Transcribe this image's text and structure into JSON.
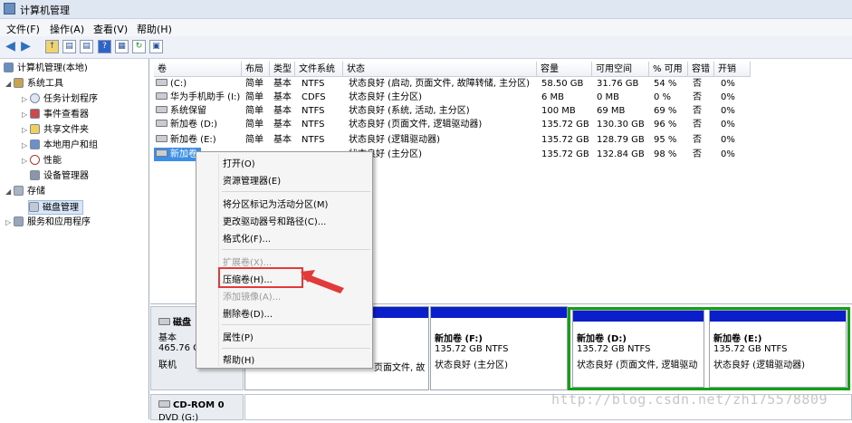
{
  "window": {
    "title": "计算机管理"
  },
  "menu": [
    "文件(F)",
    "操作(A)",
    "查看(V)",
    "帮助(H)"
  ],
  "toolbar_icons": [
    "back-arrow-icon",
    "forward-arrow-icon",
    "up-folder-icon",
    "show-hide-tree-icon",
    "properties-icon",
    "help-icon",
    "view-icon",
    "refresh-icon",
    "export-icon"
  ],
  "tree": {
    "root": "计算机管理(本地)",
    "system_tools": "系统工具",
    "task_scheduler": "任务计划程序",
    "event_viewer": "事件查看器",
    "shared_folders": "共享文件夹",
    "local_users": "本地用户和组",
    "performance": "性能",
    "device_manager": "设备管理器",
    "storage": "存储",
    "disk_management": "磁盘管理",
    "services": "服务和应用程序"
  },
  "table": {
    "headers": [
      "卷",
      "布局",
      "类型",
      "文件系统",
      "状态",
      "容量",
      "可用空间",
      "% 可用",
      "容错",
      "开销"
    ],
    "rows": [
      [
        "(C:)",
        "简单",
        "基本",
        "NTFS",
        "状态良好 (启动, 页面文件, 故障转储, 主分区)",
        "58.50 GB",
        "31.76 GB",
        "54 %",
        "否",
        "0%"
      ],
      [
        "华为手机助手 (I:)",
        "简单",
        "基本",
        "CDFS",
        "状态良好 (主分区)",
        "6 MB",
        "0 MB",
        "0 %",
        "否",
        "0%"
      ],
      [
        "系统保留",
        "简单",
        "基本",
        "NTFS",
        "状态良好 (系统, 活动, 主分区)",
        "100 MB",
        "69 MB",
        "69 %",
        "否",
        "0%"
      ],
      [
        "新加卷 (D:)",
        "简单",
        "基本",
        "NTFS",
        "状态良好 (页面文件, 逻辑驱动器)",
        "135.72 GB",
        "130.30 GB",
        "96 %",
        "否",
        "0%"
      ],
      [
        "新加卷 (E:)",
        "简单",
        "基本",
        "NTFS",
        "状态良好 (逻辑驱动器)",
        "135.72 GB",
        "128.79 GB",
        "95 %",
        "否",
        "0%"
      ],
      [
        "新加卷",
        "",
        "",
        "",
        "状态良好 (主分区)",
        "135.72 GB",
        "132.84 GB",
        "98 %",
        "否",
        "0%"
      ]
    ]
  },
  "disk0": {
    "name": "磁盘",
    "type": "基本",
    "size": "465.76 G",
    "status": "联机"
  },
  "partitions": {
    "c_fragment": "页面文件, 故",
    "f": {
      "name": "新加卷 (F:)",
      "size": "135.72 GB NTFS",
      "status": "状态良好 (主分区)"
    },
    "d": {
      "name": "新加卷 (D:)",
      "size": "135.72 GB NTFS",
      "status": "状态良好 (页面文件, 逻辑驱动"
    },
    "e": {
      "name": "新加卷 (E:)",
      "size": "135.72 GB NTFS",
      "status": "状态良好 (逻辑驱动器)"
    }
  },
  "cdrom": {
    "name": "CD-ROM 0",
    "label": "DVD (G:)"
  },
  "context_menu": {
    "open": "打开(O)",
    "explore": "资源管理器(E)",
    "mark_active": "将分区标记为活动分区(M)",
    "change_letter": "更改驱动器号和路径(C)...",
    "format": "格式化(F)...",
    "extend": "扩展卷(X)...",
    "shrink": "压缩卷(H)...",
    "add_mirror": "添加镜像(A)...",
    "delete": "删除卷(D)...",
    "properties": "属性(P)",
    "help": "帮助(H)"
  },
  "watermark": "http://blog.csdn.net/zh175578809",
  "colors": {
    "partition_bar": "#0a1fc9",
    "selection": "#3d8ee6",
    "highlight_box": "#e23a3a",
    "arrow": "#e23a3a",
    "active_partition_border": "#14a014"
  }
}
